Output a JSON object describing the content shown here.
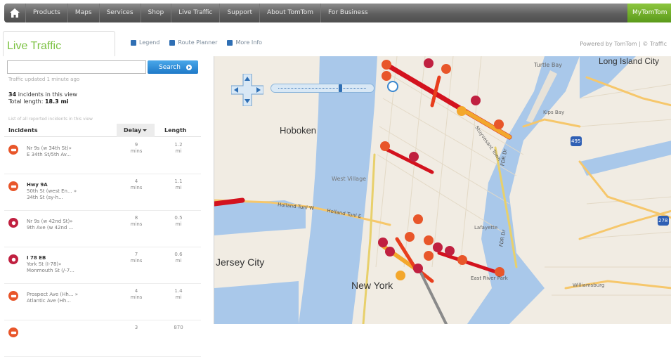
{
  "nav": {
    "items": [
      "Products",
      "Maps",
      "Services",
      "Shop",
      "Live Traffic",
      "Support",
      "About TomTom",
      "For Business"
    ],
    "my": "MyTomTom"
  },
  "header": {
    "title": "Live Traffic",
    "tabs": [
      "Legend",
      "Route Planner",
      "More Info"
    ],
    "powered": "Powered by TomTom | © Traffic"
  },
  "panel": {
    "search_value": "",
    "search_button": "Search",
    "updated": "Traffic updated 1 minute ago",
    "summary_count": "34",
    "summary_count_text": "incidents in this view",
    "summary_length_label": "Total length:",
    "summary_length": "18.3 mi",
    "sort_note": "List of all reported incidents in this view",
    "col_incidents": "Incidents",
    "col_delay": "Delay",
    "col_length": "Length",
    "rows": [
      {
        "title": "",
        "desc1": "Nr 9s (w 34th St)»",
        "desc2": "E 34th St/5th Av...",
        "delay1": "9",
        "delay2": "mins",
        "len1": "1.2",
        "len2": "mi",
        "color": "#e8562a"
      },
      {
        "title": "Hwy 9A",
        "desc1": "50th St (west En... »",
        "desc2": "34th St (sy-h...",
        "delay1": "4",
        "delay2": "mins",
        "len1": "1.1",
        "len2": "mi",
        "color": "#e8562a"
      },
      {
        "title": "",
        "desc1": "Nr 9s (w 42nd St)»",
        "desc2": "9th Ave (w 42nd ...",
        "delay1": "8",
        "delay2": "mins",
        "len1": "0.5",
        "len2": "mi",
        "color": "#c02040"
      },
      {
        "title": "I 78 EB",
        "desc1": "York St (I-78)»",
        "desc2": "Monmouth St (/-7...",
        "delay1": "7",
        "delay2": "mins",
        "len1": "0.6",
        "len2": "mi",
        "color": "#c02040"
      },
      {
        "title": "",
        "desc1": "Prospect Ave (Hh... »",
        "desc2": "Atlantic Ave (Hh...",
        "delay1": "4",
        "delay2": "mins",
        "len1": "1.4",
        "len2": "mi",
        "color": "#e8562a"
      },
      {
        "title": "",
        "desc1": "",
        "desc2": "",
        "delay1": "3",
        "delay2": "",
        "len1": "870",
        "len2": "",
        "color": "#e8562a"
      }
    ]
  },
  "map": {
    "labels": {
      "hoboken": "Hoboken",
      "jersey": "Jersey City",
      "newyork": "New York",
      "lic": "Long Island City",
      "west_village": "West Village",
      "turtle_bay": "Turtle Bay",
      "kips": "Kips Bay",
      "stuy": "Stuyvesant Town",
      "williamsburg": "Williamsburg",
      "holland": "Holland Tunl W",
      "holland2": "Holland Tunl E",
      "eastriver": "East River Park",
      "fdr": "FDR Dr",
      "fdr2": "FDR Dr",
      "lafayette": "Lafayette",
      "i495": "495",
      "i278": "278"
    }
  }
}
